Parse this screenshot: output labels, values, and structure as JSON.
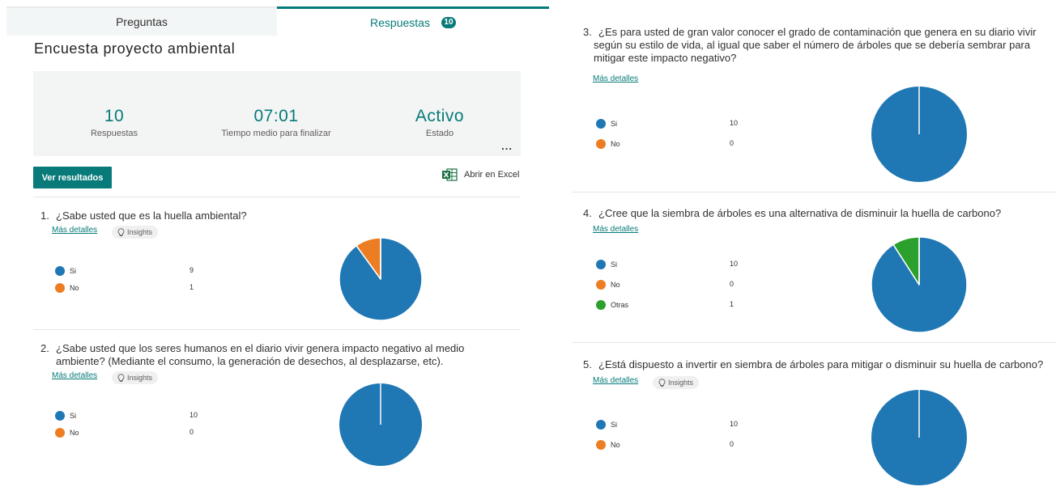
{
  "tabs": {
    "questions": "Preguntas",
    "responses": "Respuestas",
    "responses_count": "10"
  },
  "form": {
    "title": "Encuesta proyecto ambiental"
  },
  "summary": {
    "responses_value": "10",
    "responses_label": "Respuestas",
    "avg_time_value": "07:01",
    "avg_time_label": "Tiempo medio para finalizar",
    "status_value": "Activo",
    "status_label": "Estado",
    "more": "..."
  },
  "actions": {
    "view_results": "Ver resultados",
    "open_excel": "Abrir en Excel"
  },
  "colors": {
    "accent": "#077a79",
    "si": "#1f77b4",
    "no": "#ed7d22",
    "otras": "#2ca02c"
  },
  "common": {
    "more_details": "Más detalles",
    "insights": "Insights"
  },
  "questions": [
    {
      "number": "1.",
      "text": "¿Sabe usted que es la huella ambiental?",
      "has_insights": true,
      "options": [
        {
          "label": "Si",
          "count": "9"
        },
        {
          "label": "No",
          "count": "1"
        }
      ],
      "chart_data": {
        "type": "pie",
        "categories": [
          "Si",
          "No"
        ],
        "values": [
          9,
          1
        ]
      }
    },
    {
      "number": "2.",
      "text": "¿Sabe usted que los seres humanos en el diario vivir genera impacto negativo al medio ambiente? (Mediante el consumo, la generación de desechos, al desplazarse, etc).",
      "has_insights": true,
      "options": [
        {
          "label": "Si",
          "count": "10"
        },
        {
          "label": "No",
          "count": "0"
        }
      ],
      "chart_data": {
        "type": "pie",
        "categories": [
          "Si",
          "No"
        ],
        "values": [
          10,
          0
        ]
      }
    },
    {
      "number": "3.",
      "text": "¿Es para usted de gran valor conocer el grado de contaminación que genera en su diario vivir según su estilo de vida, al igual que saber el número de árboles que se debería sembrar para mitigar este impacto negativo?",
      "has_insights": false,
      "options": [
        {
          "label": "Si",
          "count": "10"
        },
        {
          "label": "No",
          "count": "0"
        }
      ],
      "chart_data": {
        "type": "pie",
        "categories": [
          "Si",
          "No"
        ],
        "values": [
          10,
          0
        ]
      }
    },
    {
      "number": "4.",
      "text": "¿Cree que la siembra de árboles es una alternativa de disminuir la huella de carbono?",
      "has_insights": false,
      "options": [
        {
          "label": "Si",
          "count": "10"
        },
        {
          "label": "No",
          "count": "0"
        },
        {
          "label": "Otras",
          "count": "1"
        }
      ],
      "chart_data": {
        "type": "pie",
        "categories": [
          "Si",
          "No",
          "Otras"
        ],
        "values": [
          10,
          0,
          1
        ]
      }
    },
    {
      "number": "5.",
      "text": "¿Está dispuesto a invertir en siembra de árboles para mitigar o disminuir su huella de carbono?",
      "has_insights": true,
      "options": [
        {
          "label": "Si",
          "count": "10"
        },
        {
          "label": "No",
          "count": "0"
        }
      ],
      "chart_data": {
        "type": "pie",
        "categories": [
          "Si",
          "No"
        ],
        "values": [
          10,
          0
        ]
      }
    }
  ]
}
